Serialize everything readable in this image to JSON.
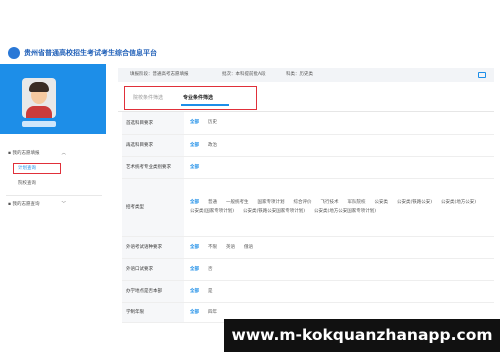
{
  "header": {
    "title": "贵州省普通高校招生考试考生综合信息平台"
  },
  "sidebar": {
    "menu_group": "我的志愿填报",
    "sub_items": [
      "计划查询",
      "院校查询"
    ],
    "menu_group2": "我的志愿查询"
  },
  "infobar": {
    "stage_label": "填报阶段：普通高考志愿填报",
    "batch_label": "批次：本科提前批A段",
    "subject_label": "科类：历史类"
  },
  "tabs": [
    {
      "label": "院校条件筛选",
      "active": false
    },
    {
      "label": "专业条件筛选",
      "active": true
    }
  ],
  "filters": [
    {
      "label": "首选科目要求",
      "options": [
        "全部",
        "历史"
      ]
    },
    {
      "label": "再选科目要求",
      "options": [
        "全部",
        "政治"
      ]
    },
    {
      "label": "艺术统考专业类别要求",
      "options": [
        "全部"
      ]
    },
    {
      "label": "招考类型",
      "options": [
        "全部",
        "普通",
        "一般统考生",
        "国家专项计划",
        "综合评价",
        "飞行技术",
        "军队院校",
        "公安类",
        "公安类(铁路公安)",
        "公安类(地方公安)",
        "公安类(国家专项计划)",
        "公安类(铁路公安国家专项计划)",
        "公安类(地方公安国家专项计划)"
      ]
    },
    {
      "label": "外语考试语种要求",
      "options": [
        "全部",
        "不限",
        "英语",
        "俄语"
      ]
    },
    {
      "label": "外语口试要求",
      "options": [
        "全部",
        "否"
      ]
    },
    {
      "label": "办学地点是否本部",
      "options": [
        "全部",
        "是"
      ]
    },
    {
      "label": "学制年限",
      "options": [
        "全部",
        "四年"
      ]
    }
  ],
  "watermark": {
    "text": "www.m-kokquanzhanapp.com"
  },
  "colors": {
    "accent": "#1d8ee8",
    "highlight": "#e0303a",
    "footer_bg": "#111111"
  }
}
